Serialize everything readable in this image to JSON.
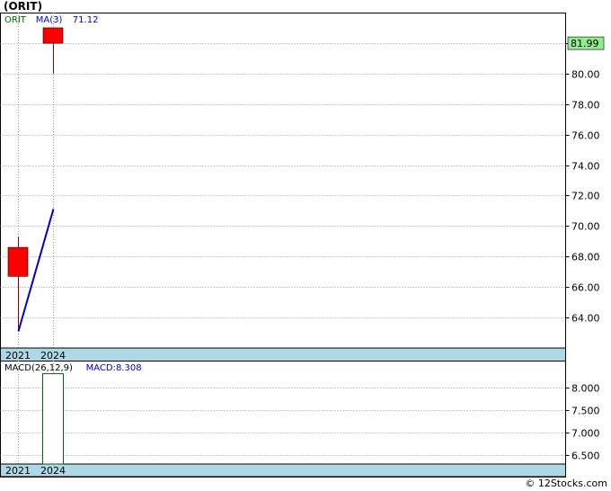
{
  "title": "(ORIT)",
  "footer": "© 12Stocks.com",
  "colors": {
    "candle": "#ff0000",
    "ma_line": "#0000cc",
    "macd_bar_border": "#006600",
    "axis_band": "#add8e6",
    "last_price_bg": "#90ee90",
    "grid": "#999999"
  },
  "chart_data": [
    {
      "type": "candlestick",
      "legend": [
        {
          "text": "ORIT",
          "color": "#006600"
        },
        {
          "text": "MA(3)",
          "color": "#0000cc"
        },
        {
          "text": "71.12",
          "color": "#0000cc"
        }
      ],
      "categories": [
        "2021",
        "2024"
      ],
      "ohlc": [
        {
          "open": 66.7,
          "high": 69.3,
          "low": 63.1,
          "close": 68.6
        },
        {
          "open": 83.0,
          "high": 83.0,
          "low": 80.0,
          "close": 81.99
        }
      ],
      "ma": {
        "name": "MA(3)",
        "values": [
          63.1,
          71.12
        ]
      },
      "yticks": [
        64,
        66,
        68,
        70,
        72,
        74,
        76,
        78,
        80,
        82
      ],
      "tick_labels": [
        "64.00",
        "66.00",
        "68.00",
        "70.00",
        "72.00",
        "74.00",
        "76.00",
        "78.00",
        "80.00",
        "82.00"
      ],
      "ylim": [
        62.0,
        84.0
      ],
      "last_price": "81.99",
      "grid": true
    },
    {
      "type": "bar",
      "legend": [
        {
          "text": "MACD(26,12,9)",
          "color": "#000000"
        },
        {
          "text": "MACD:8.308",
          "color": "#0000cc"
        }
      ],
      "categories": [
        "2021",
        "2024"
      ],
      "values": [
        null,
        8.308
      ],
      "yticks": [
        6.5,
        7.0,
        7.5,
        8.0
      ],
      "tick_labels": [
        "6.500",
        "7.000",
        "7.500",
        "8.000"
      ],
      "ylim": [
        6.3,
        8.6
      ],
      "grid": true
    }
  ]
}
